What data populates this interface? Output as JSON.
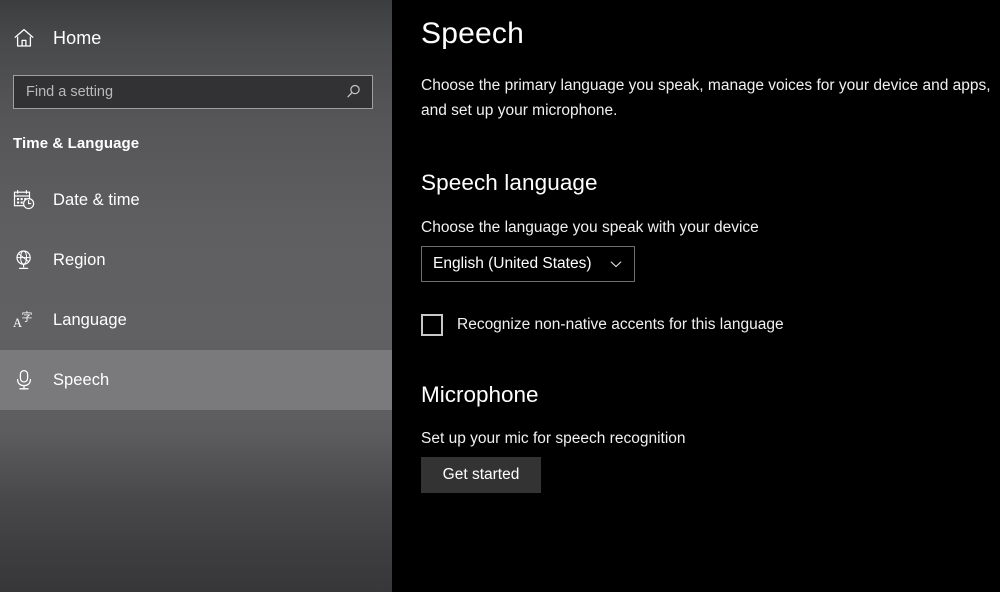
{
  "sidebar": {
    "home": {
      "label": "Home",
      "icon": "home-icon"
    },
    "search": {
      "value": "",
      "placeholder": "Find a setting",
      "icon": "search-icon"
    },
    "group_title": "Time & Language",
    "items": [
      {
        "label": "Date & time",
        "icon": "calendar-clock-icon",
        "selected": false
      },
      {
        "label": "Region",
        "icon": "globe-icon",
        "selected": false
      },
      {
        "label": "Language",
        "icon": "translate-icon",
        "selected": false
      },
      {
        "label": "Speech",
        "icon": "microphone-icon",
        "selected": true
      }
    ]
  },
  "main": {
    "title": "Speech",
    "description": "Choose the primary language you speak, manage voices for your device and apps, and set up your microphone.",
    "speech_language": {
      "section_title": "Speech language",
      "field_label": "Choose the language you speak with your device",
      "selected_value": "English (United States)",
      "chevron_icon": "chevron-down-icon",
      "checkbox": {
        "label": "Recognize non-native accents for this language",
        "checked": false
      }
    },
    "microphone": {
      "section_title": "Microphone",
      "description": "Set up your mic for speech recognition",
      "button_label": "Get started"
    }
  },
  "colors": {
    "content_background": "#000000",
    "sidebar_selected": "#7a7a7c",
    "text_primary": "#ffffff",
    "button_fill": "#333333"
  }
}
